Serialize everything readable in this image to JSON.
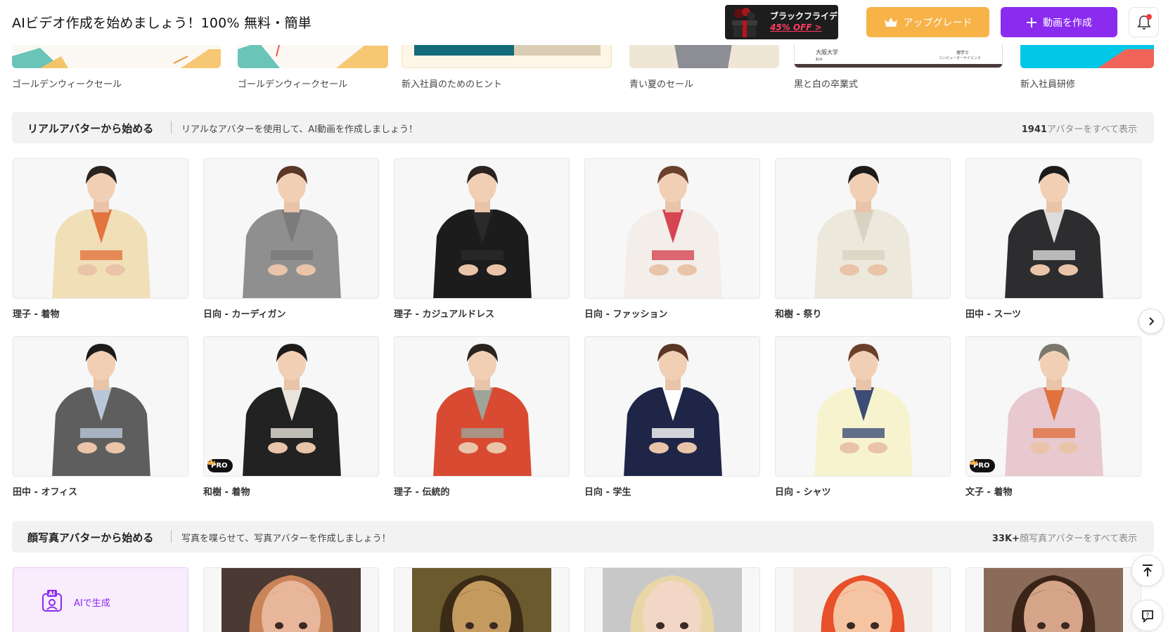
{
  "header": {
    "title": "AIビデオ作成を始めましょう！100% 無料・簡単",
    "promo_line1": "ブラックフライデー",
    "promo_line2": "45% OFF >",
    "upgrade_label": "アップグレード",
    "create_label": "動画を作成",
    "create_icon": "plus-icon",
    "upgrade_icon": "crown-icon",
    "notification_icon": "bell-icon"
  },
  "templates": [
    {
      "label": "ゴールデンウィークセール"
    },
    {
      "label": "ゴールデンウィークセール"
    },
    {
      "label": "新入社員のためのヒント"
    },
    {
      "label": "青い夏のセール"
    },
    {
      "label": "黒と白の卒業式"
    },
    {
      "label": "新入社員研修"
    }
  ],
  "template_text": {
    "graduation_left": "大阪大学",
    "graduation_sub": "鈴木",
    "graduation_right": "理学士",
    "graduation_right_sub": "コンピューターサイエンス"
  },
  "real_avatars": {
    "title": "リアルアバターから始める",
    "subtitle": "リアルなアバターを使用して、AI動画を作成しましょう！",
    "count": "1941",
    "view_all": "アバターをすべて表示",
    "next_icon": "chevron-right-icon",
    "items": [
      {
        "name": "理子 - 着物",
        "pro": false,
        "colors": {
          "body": "#f1dfb8",
          "accent": "#e2743f",
          "hair": "#2a2320"
        }
      },
      {
        "name": "日向 - カーディガン",
        "pro": false,
        "colors": {
          "body": "#8f8f8f",
          "accent": "#7b7b7b",
          "hair": "#5a3627"
        }
      },
      {
        "name": "理子 - カジュアルドレス",
        "pro": false,
        "colors": {
          "body": "#1c1c1c",
          "accent": "#2a2a2a",
          "hair": "#2a2320"
        }
      },
      {
        "name": "日向 - ファッション",
        "pro": false,
        "colors": {
          "body": "#f3eeea",
          "accent": "#d64552",
          "hair": "#6a3f2b"
        }
      },
      {
        "name": "和樹 - 祭り",
        "pro": false,
        "colors": {
          "body": "#ece8dc",
          "accent": "#d8d2c2",
          "hair": "#1d1b1a"
        }
      },
      {
        "name": "田中 - スーツ",
        "pro": false,
        "colors": {
          "body": "#2d2d30",
          "accent": "#dcdcdc",
          "hair": "#1d1b1a"
        }
      },
      {
        "name": "田中 - オフィス",
        "pro": false,
        "colors": {
          "body": "#5e5e5e",
          "accent": "#b9c8d9",
          "hair": "#1d1b1a"
        }
      },
      {
        "name": "和樹 - 着物",
        "pro": true,
        "colors": {
          "body": "#222222",
          "accent": "#e9e4dc",
          "hair": "#1d1b1a"
        }
      },
      {
        "name": "理子 - 伝統的",
        "pro": false,
        "colors": {
          "body": "#d84b32",
          "accent": "#9da59a",
          "hair": "#2a2320"
        }
      },
      {
        "name": "日向 - 学生",
        "pro": false,
        "colors": {
          "body": "#1f2547",
          "accent": "#ffffff",
          "hair": "#5a3627"
        }
      },
      {
        "name": "日向 - シャツ",
        "pro": false,
        "colors": {
          "body": "#f7f3cf",
          "accent": "#3c4d75",
          "hair": "#6a3f2b"
        }
      },
      {
        "name": "文子 - 着物",
        "pro": true,
        "colors": {
          "body": "#e7c9cf",
          "accent": "#e0723f",
          "hair": "#7a786e"
        }
      }
    ],
    "pro_label": "PRO"
  },
  "photo_avatars": {
    "title": "顔写真アバターから始める",
    "subtitle": "写真を喋らせて、写真アバターを作成しましょう！",
    "count": "33K+",
    "view_all": "顔写真アバターをすべて表示",
    "ai_generate_label": "AIで生成",
    "ai_icon": "ai-avatar-icon",
    "faces": [
      {
        "bg": "#4a3a33",
        "skin": "#e8b69a",
        "hair": "#c9845a"
      },
      {
        "bg": "#6b5a2e",
        "skin": "#c49a5e",
        "hair": "#3a2a16"
      },
      {
        "bg": "#c8c8c8",
        "skin": "#f2d7c6",
        "hair": "#e8d6a6"
      },
      {
        "bg": "#f2ece8",
        "skin": "#f5c4a2",
        "hair": "#e8502a"
      },
      {
        "bg": "#8a6a58",
        "skin": "#d6a488",
        "hair": "#3a2418"
      }
    ]
  },
  "floating": {
    "back_to_top_icon": "arrow-up-to-top-icon",
    "help_icon": "help-chat-icon"
  }
}
